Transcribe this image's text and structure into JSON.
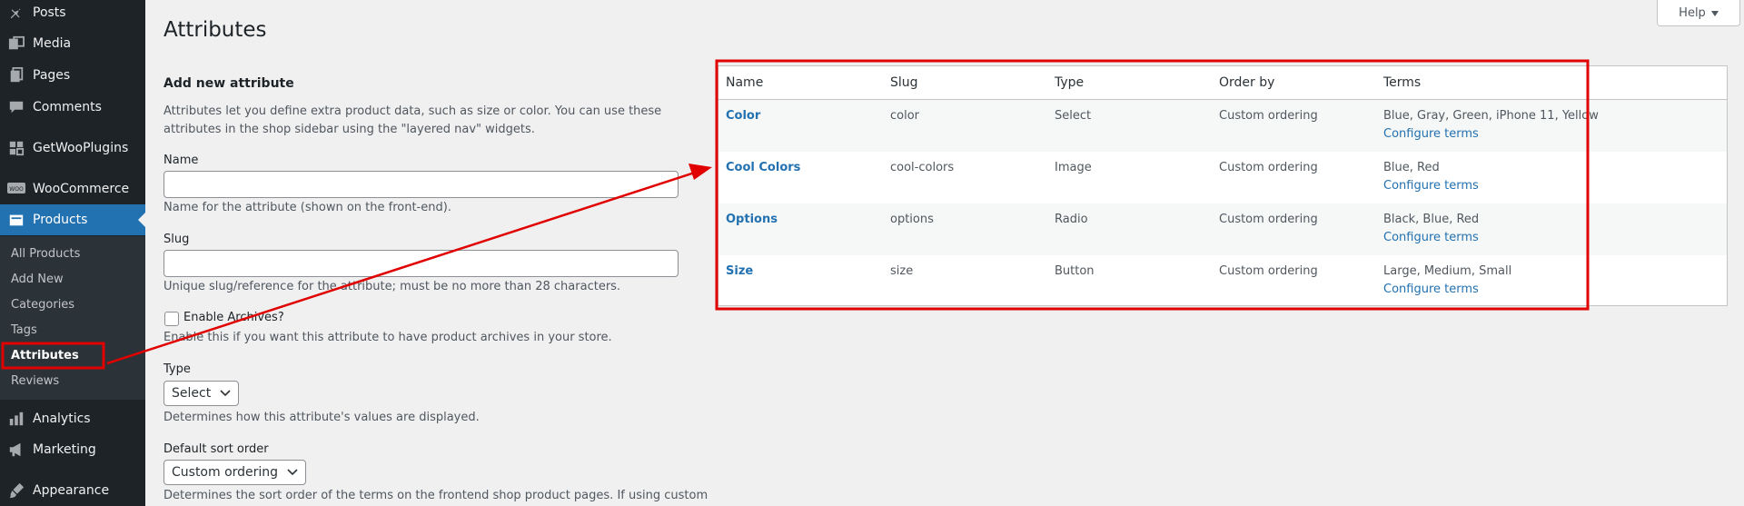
{
  "sidebar": {
    "items": [
      {
        "label": "Posts",
        "icon": "pin-icon"
      },
      {
        "label": "Media",
        "icon": "media-icon"
      },
      {
        "label": "Pages",
        "icon": "pages-icon"
      },
      {
        "label": "Comments",
        "icon": "comments-icon"
      },
      {
        "label": "GetWooPlugins",
        "icon": "grid-icon"
      },
      {
        "label": "WooCommerce",
        "icon": "woo-icon"
      },
      {
        "label": "Products",
        "icon": "archive-icon"
      },
      {
        "label": "Analytics",
        "icon": "bar-chart-icon"
      },
      {
        "label": "Marketing",
        "icon": "megaphone-icon"
      },
      {
        "label": "Appearance",
        "icon": "brush-icon"
      }
    ],
    "woo_badge": "WOO",
    "submenu": [
      "All Products",
      "Add New",
      "Categories",
      "Tags",
      "Attributes",
      "Reviews"
    ],
    "accent": "#2271b1"
  },
  "header": {
    "title": "Attributes",
    "help_label": "Help"
  },
  "form": {
    "heading": "Add new attribute",
    "intro": "Attributes let you define extra product data, such as size or color. You can use these attributes in the shop sidebar using the \"layered nav\" widgets.",
    "name_label": "Name",
    "name_value": "",
    "name_help": "Name for the attribute (shown on the front-end).",
    "slug_label": "Slug",
    "slug_value": "",
    "slug_help": "Unique slug/reference for the attribute; must be no more than 28 characters.",
    "archives_label": "Enable Archives?",
    "archives_help": "Enable this if you want this attribute to have product archives in your store.",
    "type_label": "Type",
    "type_value": "Select",
    "type_help": "Determines how this attribute's values are displayed.",
    "sort_label": "Default sort order",
    "sort_value": "Custom ordering",
    "sort_help": "Determines the sort order of the terms on the frontend shop product pages. If using custom"
  },
  "table": {
    "headers": [
      "Name",
      "Slug",
      "Type",
      "Order by",
      "Terms"
    ],
    "rows": [
      {
        "name": "Color",
        "slug": "color",
        "type": "Select",
        "order": "Custom ordering",
        "terms": "Blue, Gray, Green, iPhone 11, Yellow",
        "link": "Configure terms"
      },
      {
        "name": "Cool Colors",
        "slug": "cool-colors",
        "type": "Image",
        "order": "Custom ordering",
        "terms": "Blue, Red",
        "link": "Configure terms"
      },
      {
        "name": "Options",
        "slug": "options",
        "type": "Radio",
        "order": "Custom ordering",
        "terms": "Black, Blue, Red",
        "link": "Configure terms"
      },
      {
        "name": "Size",
        "slug": "size",
        "type": "Button",
        "order": "Custom ordering",
        "terms": "Large, Medium, Small",
        "link": "Configure terms"
      }
    ]
  },
  "annotation_color": "#e00000"
}
